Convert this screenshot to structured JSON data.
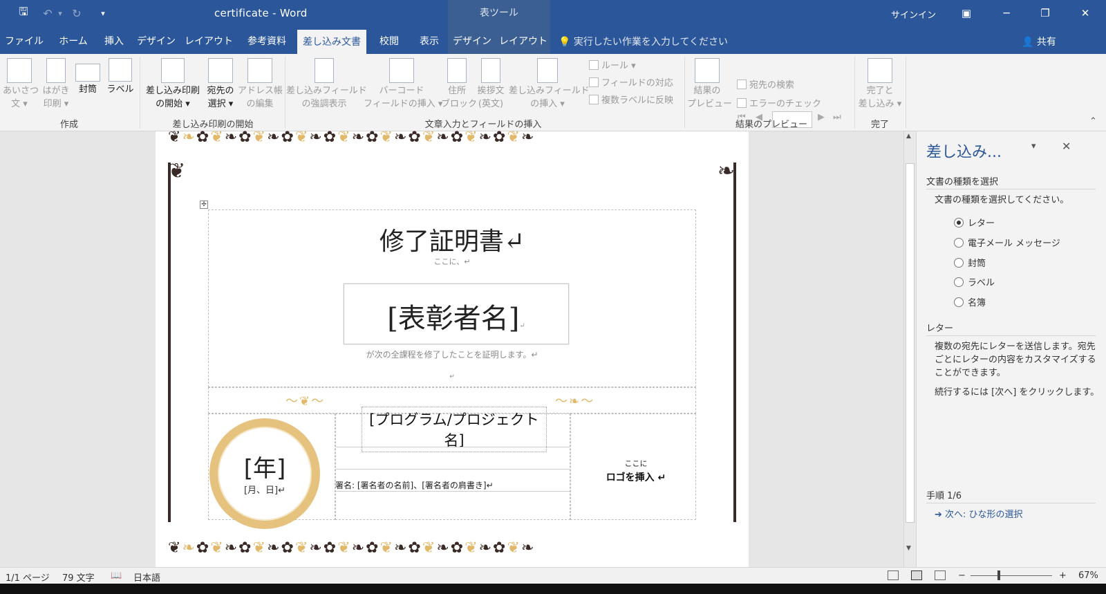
{
  "titlebar": {
    "doc": "certificate",
    "sep": "-",
    "app": "Word",
    "context_tab_group": "表ツール",
    "signin": "サインイン",
    "qat": {
      "save": "🖫",
      "undo": "↶",
      "undo_drop": "▾",
      "redo": "↻",
      "custom": "▾"
    },
    "win": {
      "restore_ribbon": "▣",
      "minimize": "─",
      "maximize": "❐",
      "close": "✕"
    }
  },
  "tabs": [
    {
      "label": "ファイル"
    },
    {
      "label": "ホーム"
    },
    {
      "label": "挿入"
    },
    {
      "label": "デザイン"
    },
    {
      "label": "レイアウト"
    },
    {
      "label": "参考資料"
    },
    {
      "label": "差し込み文書"
    },
    {
      "label": "校閲"
    },
    {
      "label": "表示"
    },
    {
      "label": "デザイン"
    },
    {
      "label": "レイアウト"
    }
  ],
  "tellme": "💡 実行したい作業を入力してください",
  "share": "👤 共有",
  "ribbon": {
    "create": {
      "greeting_1": "あいさつ",
      "greeting_2": "文 ▾",
      "postcard_1": "はがき",
      "postcard_2": "印刷 ▾",
      "envelope": "封筒",
      "label": "ラベル",
      "group": "作成"
    },
    "start": {
      "start_1": "差し込み印刷",
      "start_2": "の開始 ▾",
      "recipients_1": "宛先の",
      "recipients_2": "選択 ▾",
      "address_1": "アドレス帳",
      "address_2": "の編集",
      "group": "差し込み印刷の開始"
    },
    "fields": {
      "highlight_1": "差し込みフィールド",
      "highlight_2": "の強調表示",
      "barcode_1": "バーコード",
      "barcode_2": "フィールドの挿入 ▾",
      "address_1": "住所",
      "address_2": "ブロック",
      "greeting_1": "挨拶文",
      "greeting_2": "(英文)",
      "insert_1": "差し込みフィールド",
      "insert_2": "の挿入 ▾",
      "rules": "ルール ▾",
      "match": "フィールドの対応",
      "update": "複数ラベルに反映",
      "group": "文章入力とフィールドの挿入"
    },
    "preview": {
      "results_1": "結果の",
      "results_2": "プレビュー",
      "find": "宛先の検索",
      "check": "エラーのチェック",
      "group": "結果のプレビュー",
      "nav_first": "⏮",
      "nav_prev": "◀",
      "nav_next": "▶",
      "nav_last": "⏭"
    },
    "finish": {
      "finish_1": "完了と",
      "finish_2": "差し込み ▾",
      "group": "完了"
    },
    "collapse": "⌃"
  },
  "document": {
    "title": "修了証明書↵",
    "here": "ここに、↵",
    "recipient": "[表彰者名]",
    "recipient_mark": "↵",
    "statement": "が次の全課程を修了したことを証明します。↵",
    "mark": "↵",
    "program": "[プログラム/プロジェクト名]",
    "year": "[年]",
    "monthday": "[月、日]↵",
    "signer": "署名: [署名者の名前]、[署名者の肩書き]↵",
    "logo_here": "ここに",
    "logo_insert": "ロゴを挿入 ↵",
    "table_handle": "✢"
  },
  "pane": {
    "title": "差し込み...",
    "dropdown": "▾",
    "close": "✕",
    "section1": "文書の種類を選択",
    "instruction": "文書の種類を選択してください。",
    "options": [
      {
        "label": "レター",
        "selected": true
      },
      {
        "label": "電子メール メッセージ",
        "selected": false
      },
      {
        "label": "封筒",
        "selected": false
      },
      {
        "label": "ラベル",
        "selected": false
      },
      {
        "label": "名簿",
        "selected": false
      }
    ],
    "section2": "レター",
    "desc": "複数の宛先にレターを送信します。宛先ごとにレターの内容をカスタマイズすることができます。",
    "continue": "続行するには [次へ] をクリックします。",
    "step": "手順 1/6",
    "next": "➔ 次へ: ひな形の選択"
  },
  "status": {
    "page": "1/1 ページ",
    "words": "79 文字",
    "proof_icon": "📖",
    "lang": "日本語",
    "zoom": "67%",
    "zoom_minus": "−",
    "zoom_plus": "+"
  }
}
